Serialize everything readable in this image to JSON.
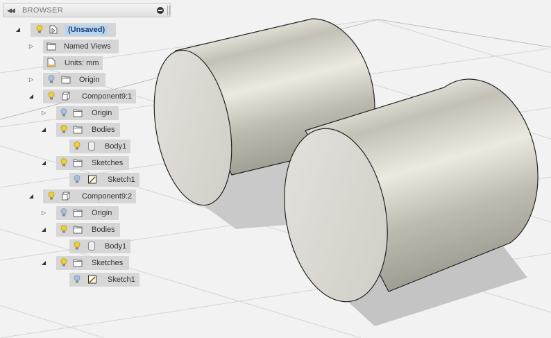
{
  "browser": {
    "title": "BROWSER",
    "collapse_icon": "double-arrow-left-icon",
    "close_icon": "minus-circle-icon"
  },
  "tree": [
    {
      "label": "(Unsaved)",
      "toggle": "expanded",
      "bulb": "on",
      "icon": "document-icon",
      "selected": true
    },
    {
      "label": "Named Views",
      "toggle": "collapsed",
      "icon": "folder-icon"
    },
    {
      "label": "Units: mm",
      "icon": "units-document-icon"
    },
    {
      "label": "Origin",
      "toggle": "collapsed",
      "bulb": "off",
      "icon": "folder-icon"
    },
    {
      "label": "Component9:1",
      "toggle": "expanded",
      "bulb": "on",
      "icon": "component-icon"
    },
    {
      "label": "Origin",
      "toggle": "collapsed",
      "bulb": "off",
      "icon": "folder-icon"
    },
    {
      "label": "Bodies",
      "toggle": "expanded",
      "bulb": "on",
      "icon": "folder-icon"
    },
    {
      "label": "Body1",
      "bulb": "on",
      "icon": "body-icon"
    },
    {
      "label": "Sketches",
      "toggle": "expanded",
      "bulb": "on",
      "icon": "folder-icon"
    },
    {
      "label": "Sketch1",
      "bulb": "off",
      "icon": "sketch-icon"
    },
    {
      "label": "Component9:2",
      "toggle": "expanded",
      "bulb": "on",
      "icon": "component-icon"
    },
    {
      "label": "Origin",
      "toggle": "collapsed",
      "bulb": "off",
      "icon": "folder-icon"
    },
    {
      "label": "Bodies",
      "toggle": "expanded",
      "bulb": "on",
      "icon": "folder-icon"
    },
    {
      "label": "Body1",
      "bulb": "on",
      "icon": "body-icon"
    },
    {
      "label": "Sketches",
      "toggle": "expanded",
      "bulb": "on",
      "icon": "folder-icon"
    },
    {
      "label": "Sketch1",
      "bulb": "off",
      "icon": "sketch-icon"
    }
  ],
  "colors": {
    "bulb_on": "#f2d12b",
    "bulb_off": "#a9bfe0",
    "selection": "#b8d4ee",
    "canvas_background": "#f2f2f2",
    "grid_line": "#d4d4d4",
    "body_face": "#dcdad2"
  }
}
